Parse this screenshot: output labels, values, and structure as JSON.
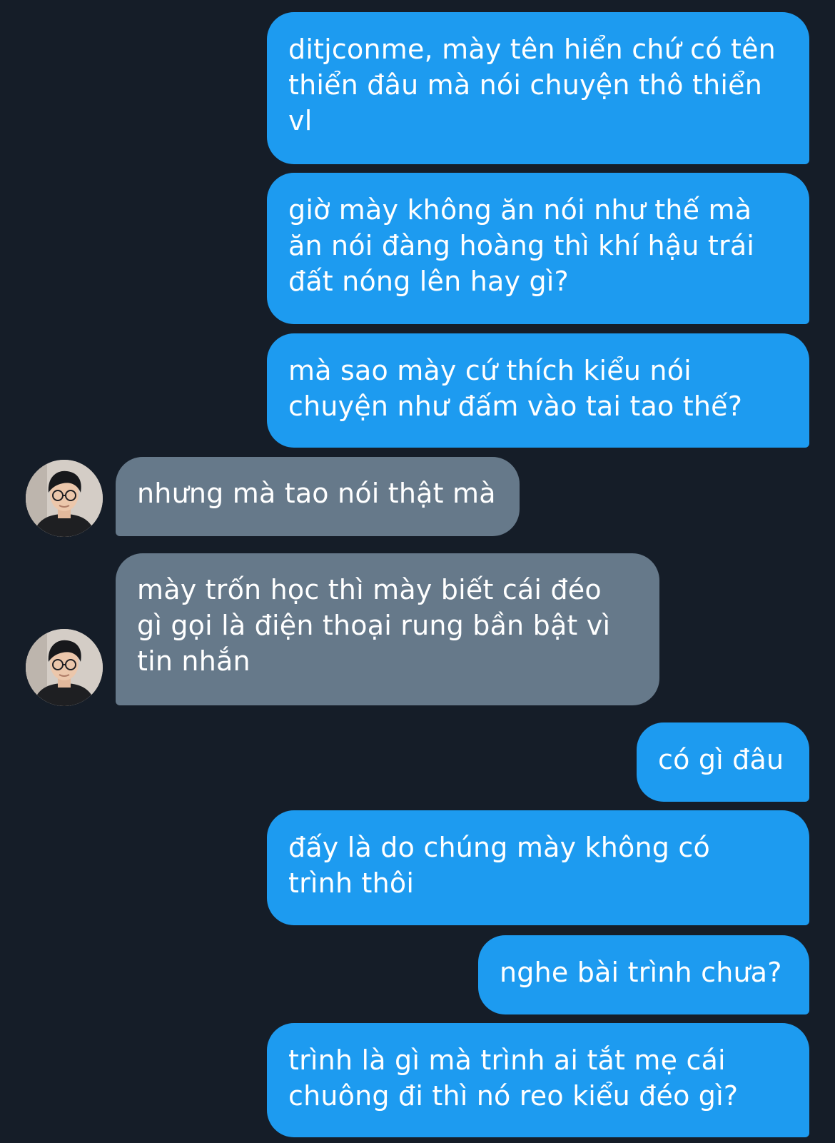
{
  "messages": [
    {
      "direction": "outgoing",
      "text": "ditjconme, mày tên hiển chứ có tên\nthiển đâu mà nói chuyện thô thiển\nvl"
    },
    {
      "direction": "outgoing",
      "text": "giờ mày không ăn nói như thế mà\năn nói đàng hoàng thì khí hậu trái\nđất nóng lên hay gì?"
    },
    {
      "direction": "outgoing",
      "text": "mà sao mày cứ thích kiểu nói\nchuyện như đấm vào tai tao thế?"
    },
    {
      "direction": "incoming",
      "text": "nhưng mà tao nói thật mà"
    },
    {
      "direction": "incoming",
      "text": "mày trốn học thì mày biết cái đéo\ngì gọi là điện thoại rung bần bật vì\ntin nhắn"
    },
    {
      "direction": "outgoing",
      "text": "có gì đâu"
    },
    {
      "direction": "outgoing",
      "text": "đấy là do chúng mày không có\ntrình thôi"
    },
    {
      "direction": "outgoing",
      "text": "nghe bài trình chưa?"
    },
    {
      "direction": "outgoing",
      "text": "trình là gì mà trình ai tắt mẹ cái\nchuông đi thì nó reo kiểu đéo gì?"
    }
  ],
  "contact": {
    "avatar_icon": "contact-avatar-photo-icon"
  },
  "colors": {
    "background": "#151d28",
    "outgoing_bubble": "#1d9bf0",
    "incoming_bubble": "#66798a",
    "text": "#ffffff"
  }
}
